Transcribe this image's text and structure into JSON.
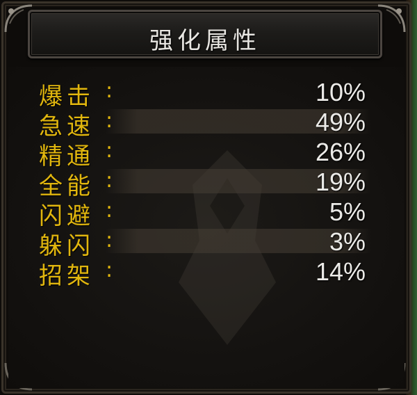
{
  "panel": {
    "title": "强化属性"
  },
  "stats": [
    {
      "label": "爆击",
      "colon": ":",
      "value": "10%"
    },
    {
      "label": "急速",
      "colon": ":",
      "value": "49%"
    },
    {
      "label": "精通",
      "colon": ":",
      "value": "26%"
    },
    {
      "label": "全能",
      "colon": ":",
      "value": "19%"
    },
    {
      "label": "闪避",
      "colon": ":",
      "value": "5%"
    },
    {
      "label": "躲闪",
      "colon": ":",
      "value": "3%"
    },
    {
      "label": "招架",
      "colon": ":",
      "value": "14%"
    }
  ],
  "colors": {
    "label": "#e1b60e",
    "value": "#ecebe8",
    "background": "#0e0c0a"
  }
}
